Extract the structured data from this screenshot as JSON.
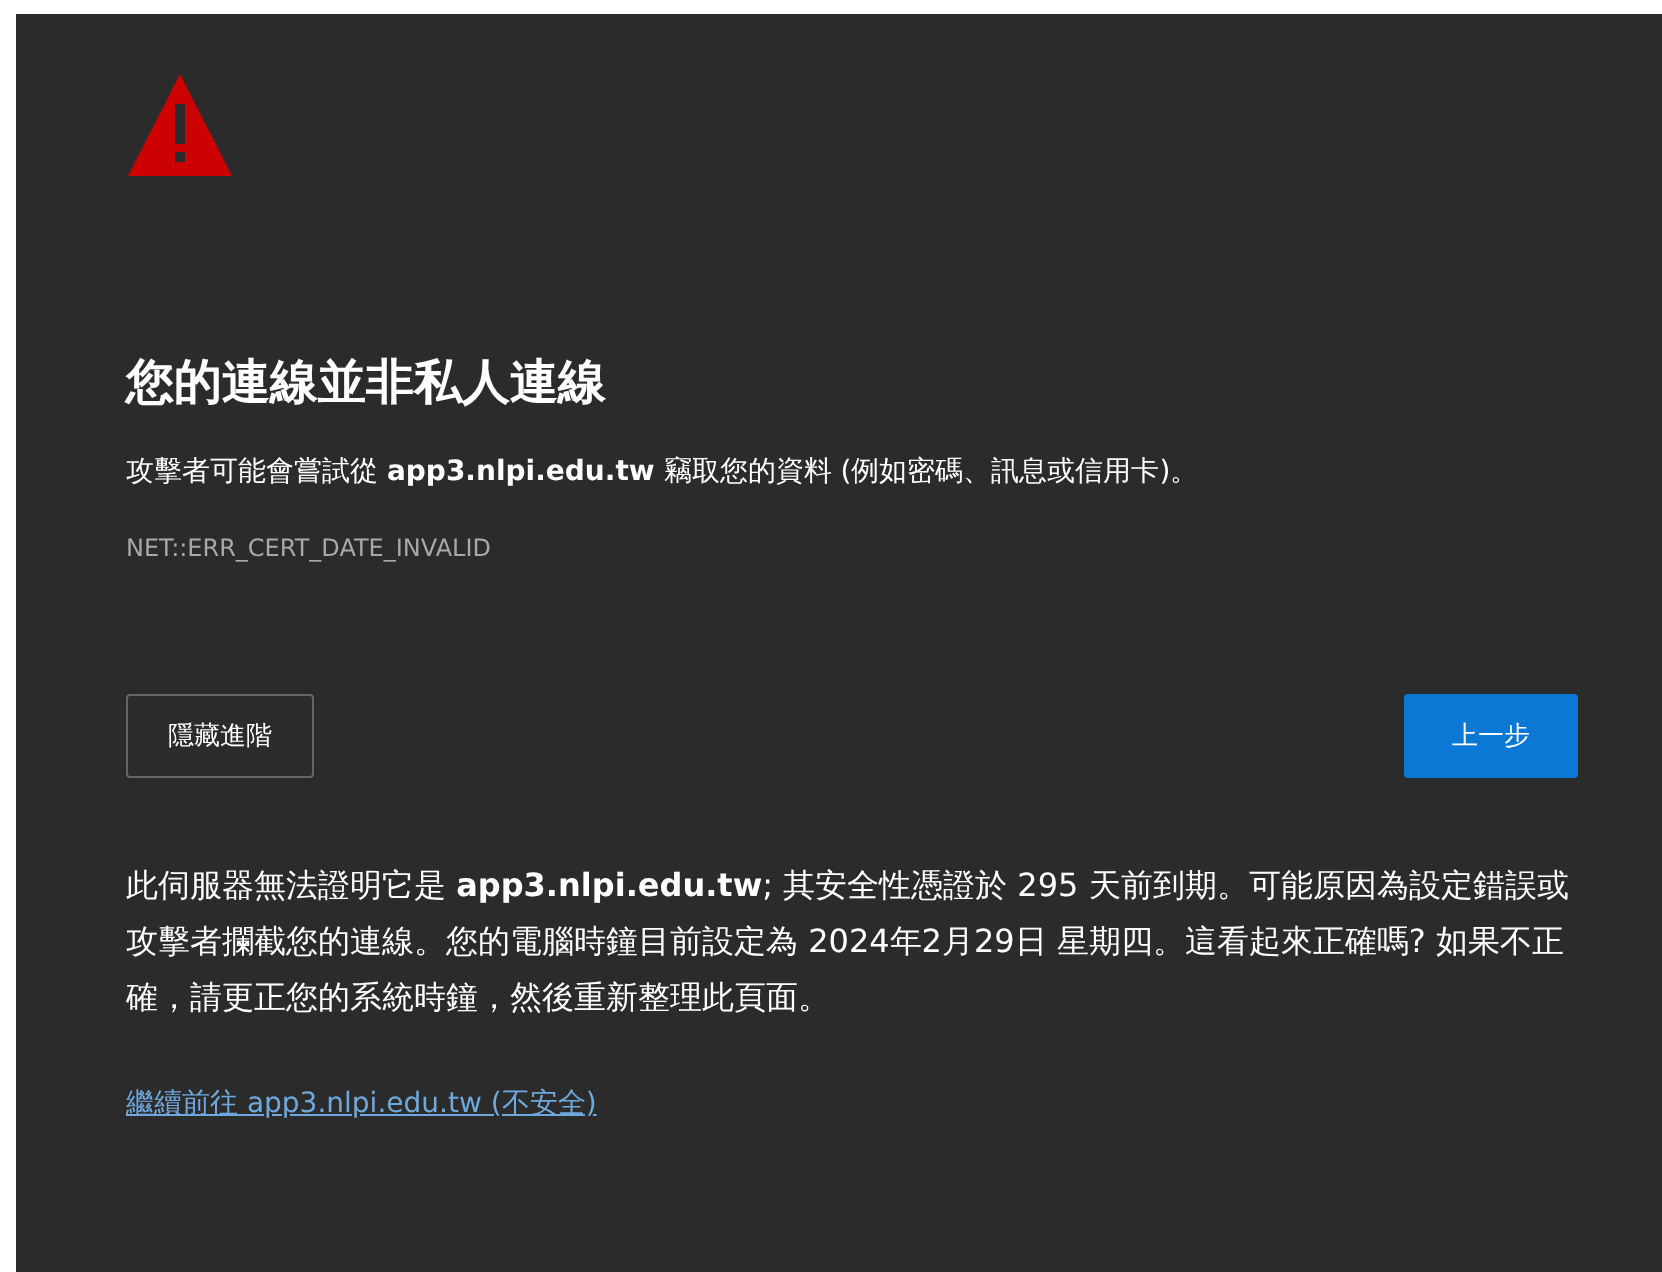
{
  "heading": "您的連線並非私人連線",
  "summary": "攻擊者可能會嘗試從 **app3.nlpi.edu.tw** 竊取您的資料 (例如密碼、訊息或信用卡)。",
  "error_code": "NET::ERR_CERT_DATE_INVALID",
  "buttons": [
    {
      "label": "隱藏進階",
      "kind": "secondary"
    },
    {
      "label": "上一步",
      "kind": "primary"
    }
  ],
  "details": "此伺服器無法證明它是 **app3.nlpi.edu.tw**; 其安全性憑證於 295 天前到期。可能原因為設定錯誤或攻擊者攔截您的連線。您的電腦時鐘目前設定為 2024年2月29日 星期四。這看起來正確嗎? 如果不正確，請更正您的系統時鐘，然後重新整理此頁面。",
  "proceed_link": "繼續前往 app3.nlpi.edu.tw (不安全)"
}
